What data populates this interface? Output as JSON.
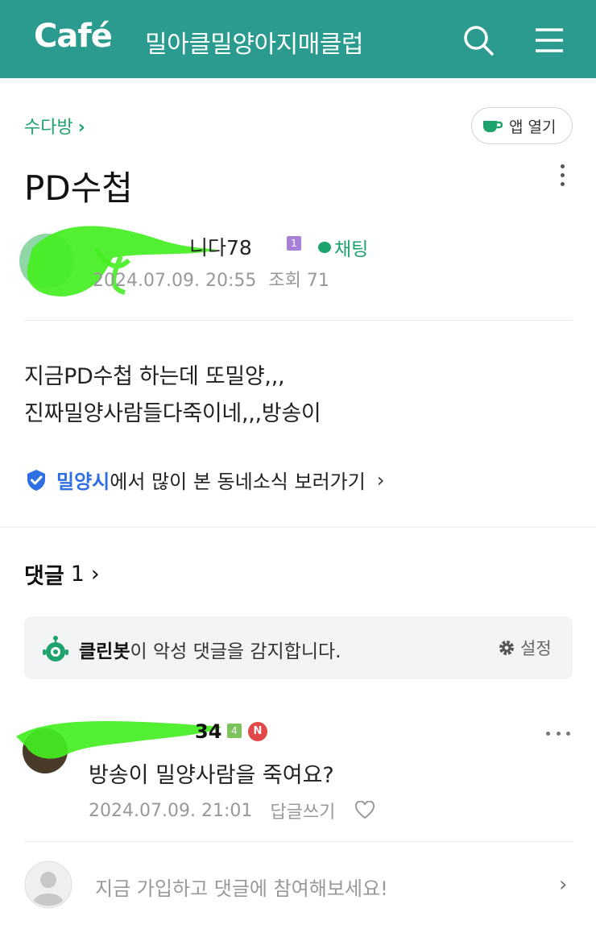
{
  "header": {
    "logo": "Café",
    "cafe_name": "밀아클밀양아지매클럽",
    "icons": [
      "search-icon",
      "menu-icon"
    ],
    "bg_color": "#2a9b8e"
  },
  "breadcrumb": {
    "label": "수다방",
    "chevron": "›"
  },
  "app_open": {
    "label": "앱 열기",
    "icon": "coffee-cup-icon"
  },
  "post": {
    "title": "PD수첩",
    "author_name_visible": "니다78",
    "author_level": "1",
    "chat_label": "채팅",
    "date": "2024.07.09. 20:55",
    "views": "조회 71",
    "body_lines": [
      "지금PD수첩 하는데 또밀양,,,",
      "진짜밀양사람들다죽이네,,,방송이"
    ]
  },
  "local_news": {
    "town": "밀양시",
    "text": "에서 많이 본 동네소식 보러가기",
    "chevron": "›"
  },
  "comments_header": {
    "label": "댓글",
    "count": "1",
    "chevron": "›"
  },
  "cleanbot": {
    "name": "클린봇",
    "text": "이 악성 댓글을 감지합니다.",
    "settings": "설정"
  },
  "comment": {
    "author_visible": "34",
    "level": "4",
    "new_badge": "N",
    "text": "방송이 밀양사람을 죽여요?",
    "date": "2024.07.09. 21:01",
    "reply_label": "답글쓰기"
  },
  "join_prompt": {
    "text": "지금 가입하고 댓글에 참여해보세요!",
    "chevron": "›"
  }
}
